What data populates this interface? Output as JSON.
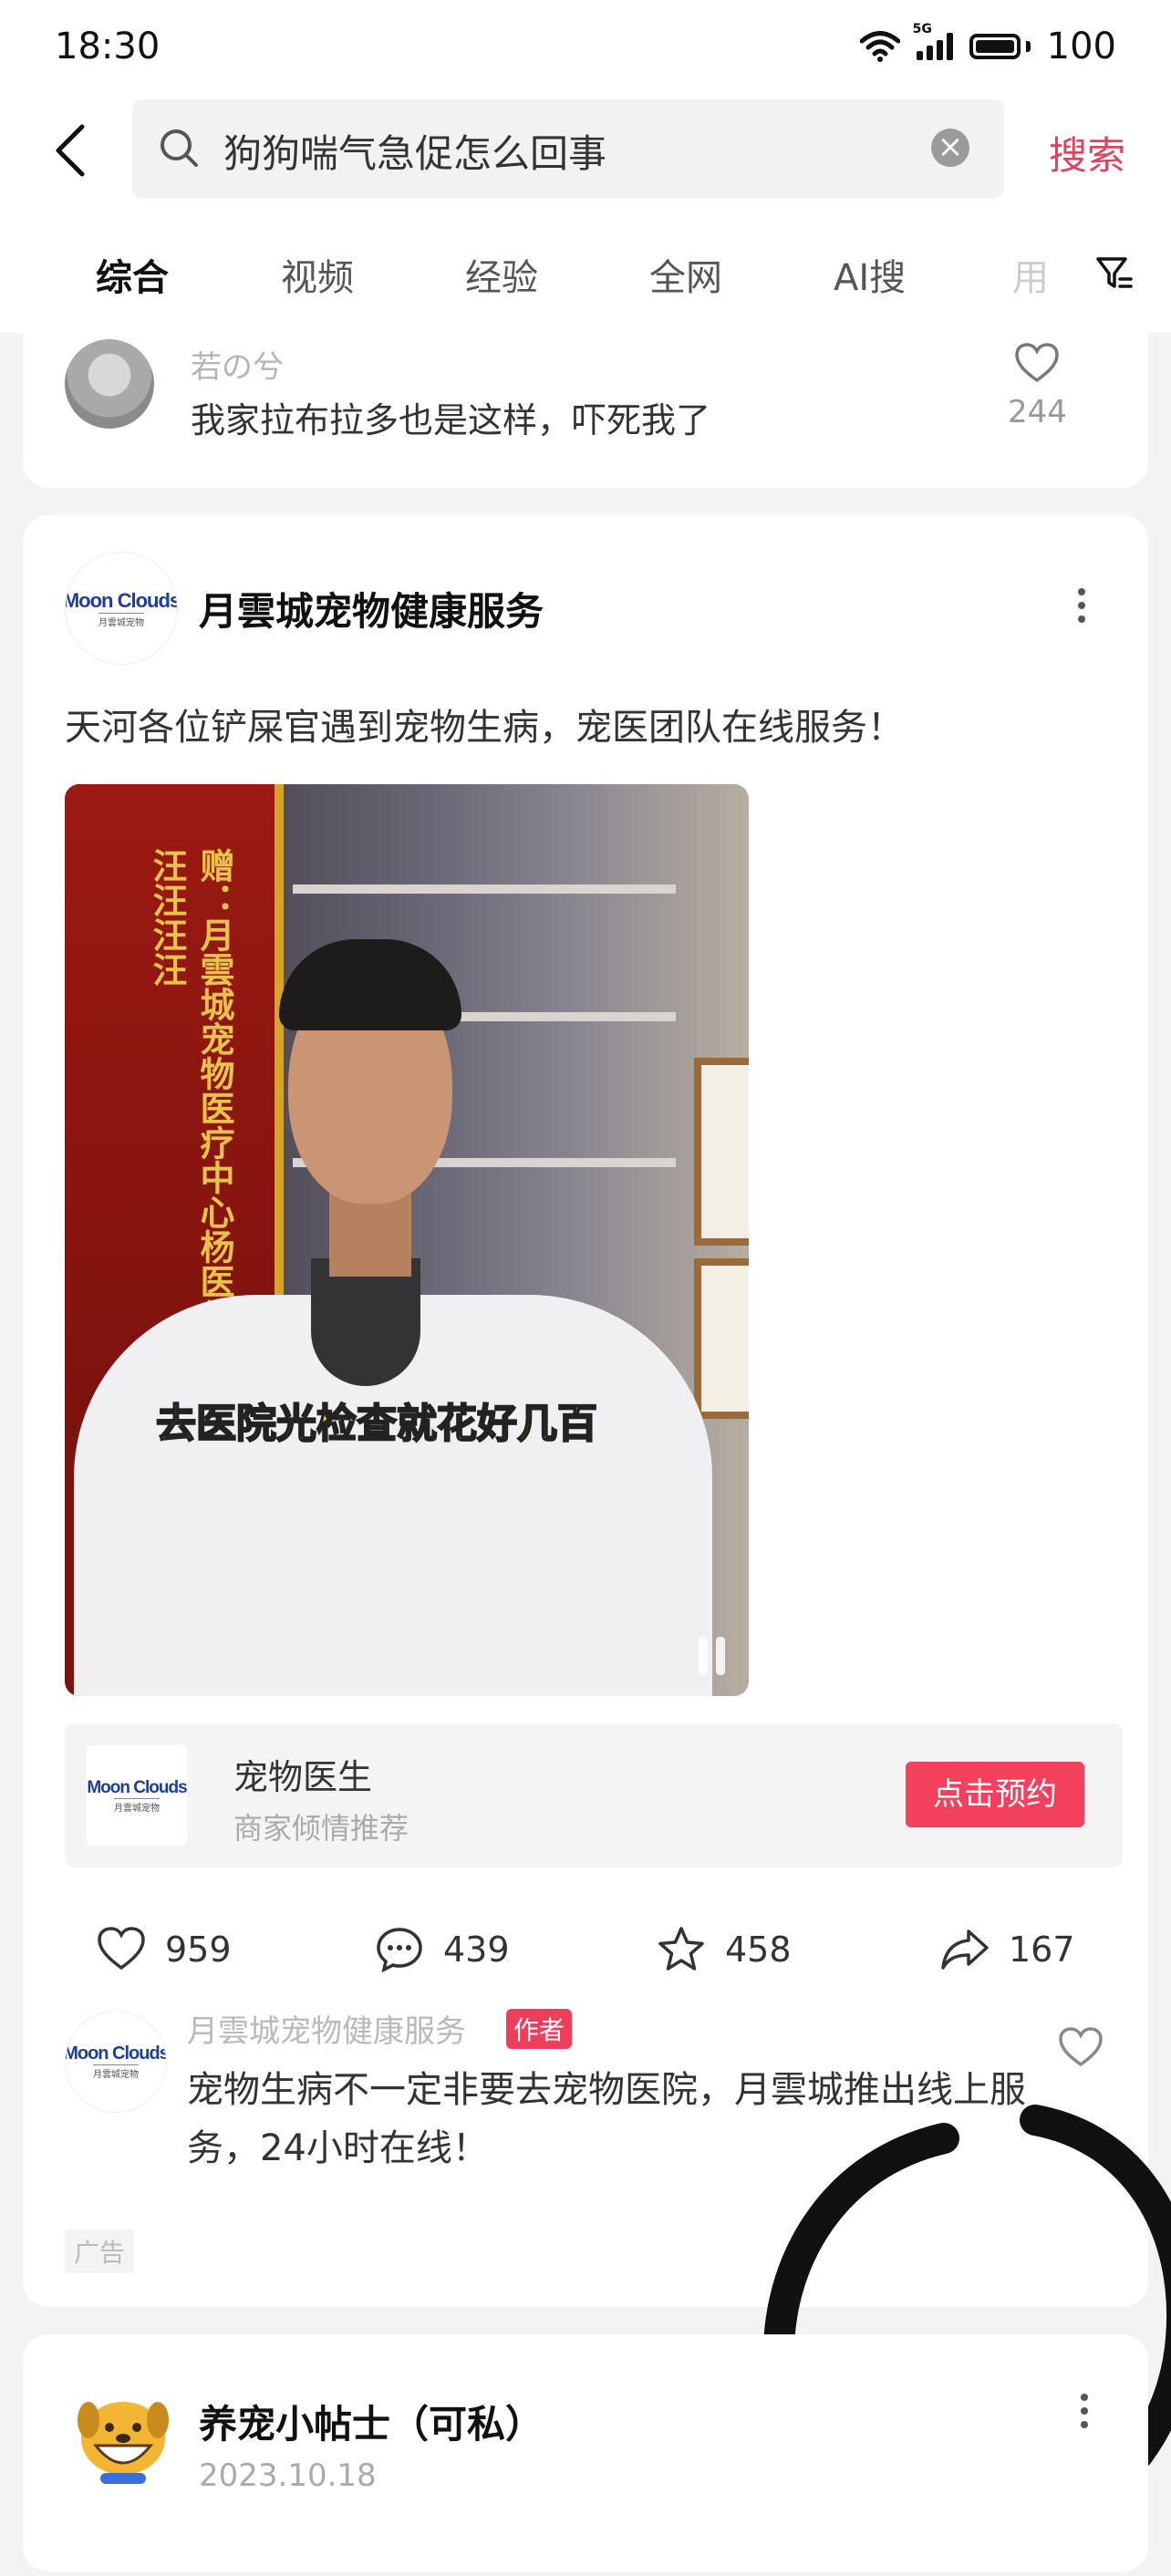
{
  "status_bar": {
    "time": "18:30",
    "network": "5G",
    "battery": "100"
  },
  "search": {
    "query": "狗狗喘气急促怎么回事",
    "button_label": "搜索"
  },
  "tabs": [
    {
      "label": "综合",
      "active": true
    },
    {
      "label": "视频"
    },
    {
      "label": "经验"
    },
    {
      "label": "全网"
    },
    {
      "label": "AI搜"
    },
    {
      "label": "用"
    }
  ],
  "comment_top": {
    "user": "若の兮",
    "text": "我家拉布拉多也是这样，吓死我了",
    "likes": "244"
  },
  "ad_post": {
    "account": "月雲城宠物健康服务",
    "logo_text": "Moon Clouds",
    "logo_sub": "月雲城宠物",
    "description": "天河各位铲屎官遇到宠物生病，宠医团队在线服务！",
    "video_banner_text": "赠：月雲城宠物医疗中心杨医生 汪汪汪汪汪汪",
    "video_caption": "去医院光检查就花好几百",
    "promo": {
      "title": "宠物医生",
      "subtitle": "商家倾情推荐",
      "button": "点击预约"
    },
    "stats": {
      "likes": "959",
      "comments": "439",
      "favorites": "458",
      "shares": "167"
    },
    "author_comment": {
      "user": "月雲城宠物健康服务",
      "badge": "作者",
      "text": "宠物生病不一定非要去宠物医院，月雲城推出线上服务，24小时在线！"
    },
    "ad_label": "广告"
  },
  "next_post": {
    "account": "养宠小帖士（可私）",
    "date": "2023.10.18"
  },
  "colors": {
    "accent": "#e0415e",
    "button": "#f2405d",
    "logo_blue": "#1d3f9a"
  }
}
